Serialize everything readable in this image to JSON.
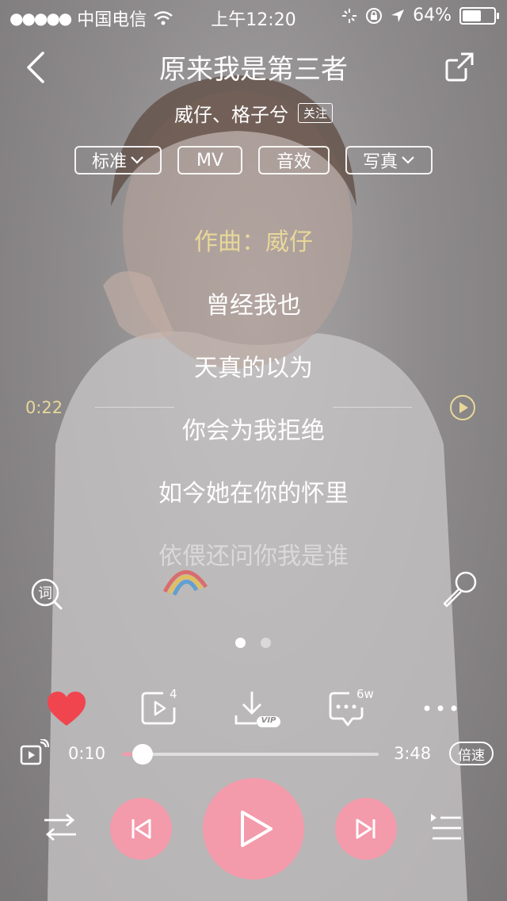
{
  "status_bar": {
    "signal": "●●●●●",
    "carrier": "中国电信",
    "time": "上午12:20",
    "battery_percent": "64%",
    "battery_level": 0.64
  },
  "header": {
    "title": "原来我是第三者",
    "artists": "威仔、格子兮",
    "follow_label": "关注"
  },
  "pills": {
    "quality": "标准",
    "mv": "MV",
    "effects": "音效",
    "photo": "写真"
  },
  "lyrics": {
    "lines": [
      "作曲：威仔",
      "曾经我也",
      "天真的以为",
      "你会为我拒绝",
      "如今她在你的怀里",
      "依偎还问你我是谁"
    ],
    "active_index": 0,
    "seek_time": "0:22"
  },
  "actions": {
    "share_count": "4",
    "comment_count": "6w",
    "vip_label": "VIP"
  },
  "playback": {
    "current_time": "0:10",
    "total_time": "3:48",
    "progress": 0.08,
    "speed_label": "倍速"
  },
  "pager": {
    "count": 2,
    "active": 0
  },
  "colors": {
    "accent_pink": "#f39aab",
    "active_lyric": "#e8d79a",
    "heart": "#f0454f"
  }
}
